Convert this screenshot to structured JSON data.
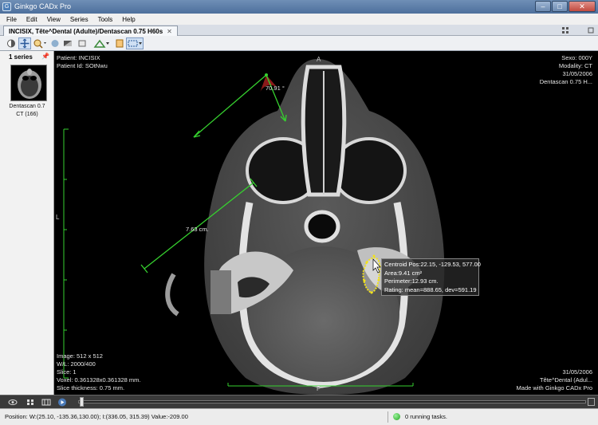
{
  "window": {
    "title": "Ginkgo CADx Pro",
    "icon": "G",
    "minimize": "–",
    "maximize": "□",
    "close": "✕"
  },
  "menu": [
    "File",
    "Edit",
    "View",
    "Series",
    "Tools",
    "Help"
  ],
  "tab": {
    "label": "INCISIX, Tête^Dental (Adulte)/Dentascan  0.75  H60s",
    "close": "✕"
  },
  "toolbar": {
    "layout_icon": "layout-grid-icon"
  },
  "series": {
    "header": "1 series",
    "thumb_caption_line1": "Dentascan  0.7",
    "thumb_caption_line2": "CT (166)"
  },
  "overlay": {
    "patient_name": "Patient: INCISIX",
    "patient_id": "Patient Id: SOtNwu",
    "sex": "Sexo: 000Y",
    "modality": "Modality: CT",
    "date_top": "31/05/2006",
    "series_name": "Dentascan 0.75 H...",
    "image_size": "Image: 512 x 512",
    "wl": "W/L: 2000/400",
    "slice": "Slice: 1",
    "voxel": "Voxel: 0.361328x0.361328 mm.",
    "thickness": "Slice thickness: 0.75 mm.",
    "date_bottom": "31/05/2006",
    "study": "Tête^Dental (Adul...",
    "made_with": "Made with Ginkgo CADx Pro",
    "orient_top": "A",
    "orient_left": "L",
    "orient_bottom": "P"
  },
  "measurements": {
    "angle": "70.91 °",
    "distance": "7.63 cm."
  },
  "roi": {
    "centroid": "Centroid Pos:22.15, -129.53, 577.00",
    "area": "Area:9.41 cm²",
    "perimeter": "Perimeter:12.93 cm.",
    "rating": "Rating: mean=888.65, dev=591.19"
  },
  "status": {
    "position": "Position: W:(25.10, -135.36,130.00); I:(336.05, 315.39) Value:-209.00",
    "tasks": "0 running tasks."
  },
  "colors": {
    "measure": "#36d12f",
    "roi": "#f2e21a",
    "angle_arc": "#8b1a1a"
  }
}
